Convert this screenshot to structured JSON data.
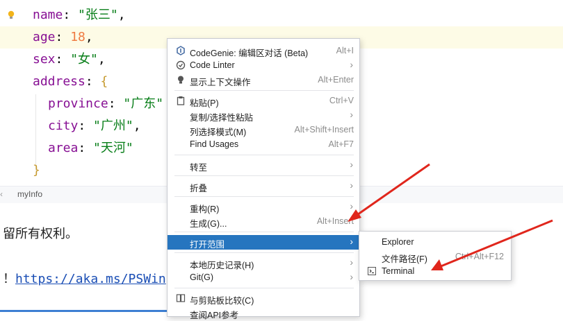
{
  "editor": {
    "lines": [
      {
        "key": "name",
        "colon": ": ",
        "value": "\"张三\"",
        "trail": ","
      },
      {
        "key": "age",
        "colon": ": ",
        "value": "18",
        "trail": ","
      },
      {
        "key": "sex",
        "colon": ": ",
        "value": "\"女\"",
        "trail": ","
      },
      {
        "key": "address",
        "colon": ": ",
        "value": "{",
        "trail": ""
      },
      {
        "key": "province",
        "colon": ": ",
        "value": "\"广东\"",
        "trail": ""
      },
      {
        "key": "city",
        "colon": ": ",
        "value": "\"广州\"",
        "trail": ","
      },
      {
        "key": "area",
        "colon": ": ",
        "value": "\"天河\"",
        "trail": ""
      },
      {
        "key": "",
        "colon": "",
        "value": "}",
        "trail": ""
      }
    ]
  },
  "breadcrumb": {
    "chevron": "‹",
    "item": "myInfo"
  },
  "terminal": {
    "line1": "留所有权利。",
    "line2_prefix": "！",
    "line2_link": "https://aka.ms/PSWin"
  },
  "context_menu": {
    "items": [
      {
        "icon": "codegenie-icon",
        "label": "CodeGenie: 编辑区对话 (Beta)",
        "shortcut": "Alt+I",
        "submenu": false
      },
      {
        "icon": "code-linter-icon",
        "label": "Code Linter",
        "shortcut": "",
        "submenu": true
      },
      {
        "icon": "bulb-icon",
        "label": "显示上下文操作",
        "shortcut": "Alt+Enter",
        "submenu": false
      },
      {
        "icon": "clipboard-icon",
        "label": "粘贴(P)",
        "shortcut": "Ctrl+V",
        "submenu": false
      },
      {
        "icon": "",
        "label": "复制/选择性粘贴",
        "shortcut": "",
        "submenu": true
      },
      {
        "icon": "",
        "label": "列选择模式(M)",
        "shortcut": "Alt+Shift+Insert",
        "submenu": false
      },
      {
        "icon": "",
        "label": "Find Usages",
        "shortcut": "Alt+F7",
        "submenu": false
      },
      {
        "icon": "",
        "label": "转至",
        "shortcut": "",
        "submenu": true
      },
      {
        "icon": "",
        "label": "折叠",
        "shortcut": "",
        "submenu": true
      },
      {
        "icon": "",
        "label": "重构(R)",
        "shortcut": "",
        "submenu": true
      },
      {
        "icon": "",
        "label": "生成(G)...",
        "shortcut": "Alt+Insert",
        "submenu": false
      },
      {
        "icon": "",
        "label": "打开范围",
        "shortcut": "",
        "submenu": true,
        "selected": true
      },
      {
        "icon": "",
        "label": "本地历史记录(H)",
        "shortcut": "",
        "submenu": true
      },
      {
        "icon": "",
        "label": "Git(G)",
        "shortcut": "",
        "submenu": true
      },
      {
        "icon": "compare-icon",
        "label": "与剪贴板比较(C)",
        "shortcut": "",
        "submenu": false
      },
      {
        "icon": "",
        "label": "查阅API参考",
        "shortcut": "",
        "submenu": false
      }
    ]
  },
  "submenu": {
    "items": [
      {
        "label": "Explorer",
        "shortcut": ""
      },
      {
        "label": "文件路径(F)",
        "shortcut": "Ctrl+Alt+F12"
      },
      {
        "label": "Terminal",
        "shortcut": "",
        "icon": "terminal-icon"
      }
    ]
  },
  "colors": {
    "selection": "#2675bf",
    "arrow": "#e0261c"
  }
}
